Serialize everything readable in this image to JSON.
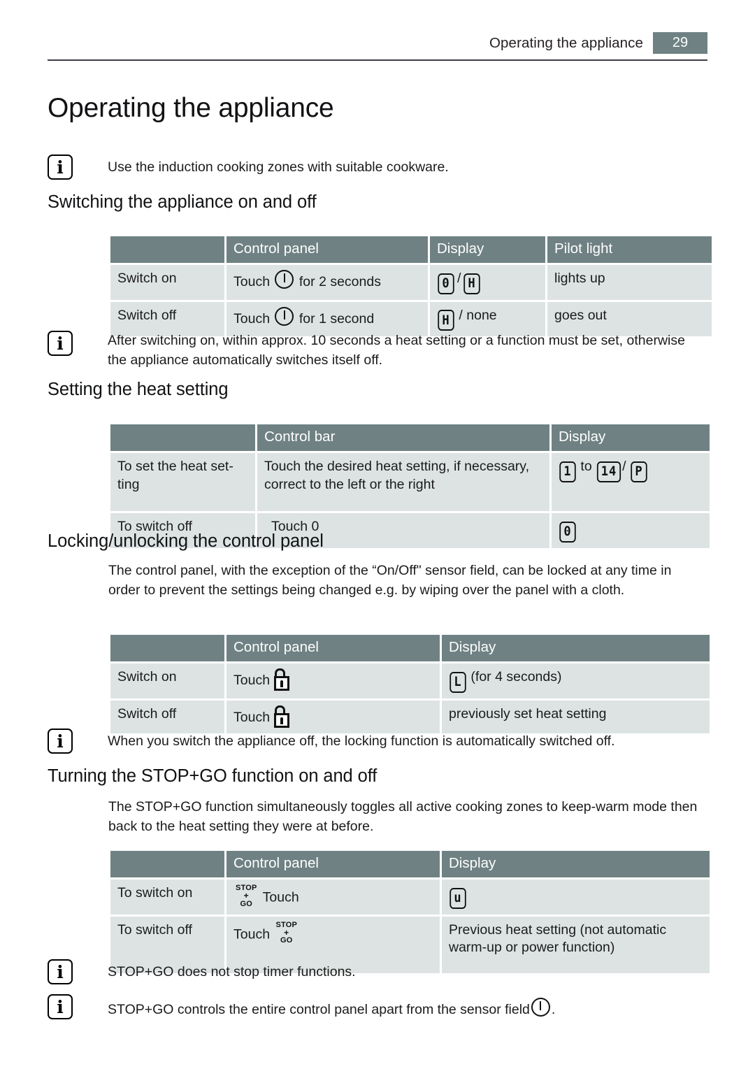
{
  "header": {
    "title": "Operating the appliance",
    "page_number": "29"
  },
  "doc_title": "Operating the appliance",
  "notes": {
    "cookware": "Use the induction cooking zones with suitable cookware.",
    "ten_seconds": "After switching on, within approx. 10 seconds a heat setting or a function must be set, otherwise the appliance automatically switches itself off.",
    "locking_off": "When you switch the appliance off, the locking function is automatically switched off.",
    "timer": "STOP+GO does not stop timer functions.",
    "sensor_field_prefix": "STOP+GO controls the entire control panel apart from the sensor field",
    "sensor_field_suffix": "."
  },
  "sections": {
    "switching": {
      "heading": "Switching the appliance on and off",
      "table": {
        "headers": [
          "",
          "Control panel",
          "Display",
          "Pilot light"
        ],
        "rows": [
          {
            "action": "Switch on",
            "control_prefix": "Touch",
            "control_suffix": "for 2 seconds",
            "display": [
              "0",
              "/",
              "H"
            ],
            "pilot": "lights up"
          },
          {
            "action": "Switch off",
            "control_prefix": "Touch",
            "control_suffix": "for 1 second",
            "display": [
              "H",
              "/ none"
            ],
            "pilot": "goes out"
          }
        ]
      }
    },
    "heat_setting": {
      "heading": "Setting the heat setting",
      "table": {
        "headers": [
          "",
          "Control bar",
          "Display"
        ],
        "rows": [
          {
            "action": "To set the heat set-ting",
            "control": "Touch the desired heat setting, if necessary, correct to the left or the right",
            "display_from": "1",
            "display_to_label": "to",
            "display_max": "14",
            "display_sep": "/",
            "display_power": "P"
          },
          {
            "action": "To switch off",
            "control": "Touch 0",
            "display_from": "0"
          }
        ]
      }
    },
    "locking": {
      "heading": "Locking/unlocking the control panel",
      "paragraph": "The control panel, with the exception of the “On/Off\" sensor field, can be locked at any time in order to prevent the settings being changed e.g. by wiping over the panel with a cloth.",
      "table": {
        "headers": [
          "",
          "Control panel",
          "Display"
        ],
        "rows": [
          {
            "action": "Switch on",
            "control_prefix": "Touch",
            "display_glyph": "L",
            "display_text": "(for 4 seconds)"
          },
          {
            "action": "Switch off",
            "control_prefix": "Touch",
            "display_text": "previously set heat setting"
          }
        ]
      }
    },
    "stopgo": {
      "heading": "Turning the STOP+GO function on and off",
      "paragraph": "The STOP+GO function simultaneously toggles all active cooking zones to keep-warm mode then back to the heat setting they were at before.",
      "icon_lines": [
        "STOP",
        "+",
        "GO"
      ],
      "table": {
        "headers": [
          "",
          "Control panel",
          "Display"
        ],
        "rows": [
          {
            "action": "To switch on",
            "control_text": "Touch",
            "icon_first": true,
            "display_glyph": "u",
            "display_text": ""
          },
          {
            "action": "To switch off",
            "control_text": "Touch",
            "icon_first": false,
            "display_text": "Previous heat setting (not automatic warm-up or power function)"
          }
        ]
      }
    }
  },
  "colors": {
    "header_bar": "#6f8183",
    "cell_bg": "#dde3e3",
    "rule": "#3b3f46"
  }
}
